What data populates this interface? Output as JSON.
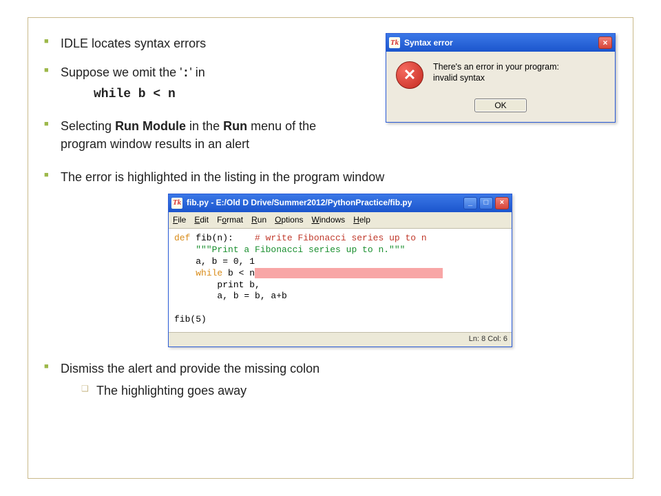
{
  "bullets": {
    "b1": "IDLE locates syntax errors",
    "b2_pre": "Suppose we omit the '",
    "b2_colon": ":",
    "b2_post": "' in",
    "b2_code": "while b < n",
    "b3_a": "Selecting ",
    "b3_bold1": "Run Module",
    "b3_b": " in the ",
    "b3_bold2": "Run",
    "b3_c": " menu of the program window results in an alert",
    "b4": "The error is highlighted in the listing in the program window",
    "b5": "Dismiss the alert and provide the missing colon",
    "b5_sub": "The highlighting goes away"
  },
  "dialog": {
    "title": "Syntax error",
    "app_icon": "Tk",
    "body_line1": "There's an error in your program:",
    "body_line2": "invalid syntax",
    "ok": "OK"
  },
  "idle": {
    "title": "fib.py - E:/Old D Drive/Summer2012/PythonPractice/fib.py",
    "app_icon": "Tk",
    "menu": {
      "file": "File",
      "edit": "Edit",
      "format": "Format",
      "run": "Run",
      "options": "Options",
      "windows": "Windows",
      "help": "Help"
    },
    "code": {
      "l1a": "def",
      "l1b": " fib(n):    ",
      "l1c": "# write Fibonacci series up to n",
      "l2": "    \"\"\"Print a Fibonacci series up to n.\"\"\"",
      "l3": "    a, b = 0, 1",
      "l4a": "    ",
      "l4b": "while",
      "l4c": " b < n",
      "l4hlpad": "                                   ",
      "l5": "        print b,",
      "l6": "        a, b = b, a+b",
      "l7": "",
      "l8": "fib(5)"
    },
    "status": "Ln: 8 Col: 6"
  }
}
